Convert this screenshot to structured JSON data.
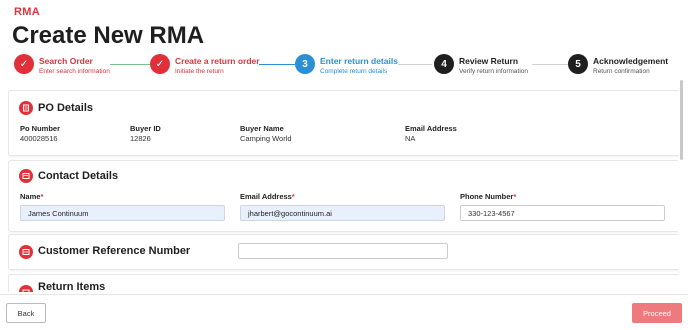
{
  "brand": "RMA",
  "title": "Create New RMA",
  "colors": {
    "accent": "#e0313a",
    "active": "#2b8fd6",
    "todo": "#1f1f1f",
    "proceed": "#ef7a7d"
  },
  "steps": [
    {
      "num": "✓",
      "title": "Search Order",
      "subtitle": "Enter search information",
      "state": "done"
    },
    {
      "num": "✓",
      "title": "Create a return order",
      "subtitle": "Initiate the return",
      "state": "done"
    },
    {
      "num": "3",
      "title": "Enter return details",
      "subtitle": "Complete return details",
      "state": "active"
    },
    {
      "num": "4",
      "title": "Review Return",
      "subtitle": "Verify return information",
      "state": "todo"
    },
    {
      "num": "5",
      "title": "Acknowledgement",
      "subtitle": "Return confirmation",
      "state": "todo"
    }
  ],
  "po": {
    "title": "PO Details",
    "fields": [
      {
        "label": "Po Number",
        "value": "400028516"
      },
      {
        "label": "Buyer ID",
        "value": "12826"
      },
      {
        "label": "Buyer Name",
        "value": "Camping World"
      },
      {
        "label": "Email Address",
        "value": "NA"
      }
    ]
  },
  "contact": {
    "title": "Contact Details",
    "name_label": "Name",
    "name_value": "James Continuum",
    "email_label": "Email Address",
    "email_value": "jharbert@gocontinuum.ai",
    "phone_label": "Phone Number",
    "phone_value": "330-123-4567",
    "required_mark": "*"
  },
  "customer_ref": {
    "title": "Customer Reference Number",
    "value": ""
  },
  "return_items": {
    "title": "Return Items"
  },
  "buttons": {
    "back": "Back",
    "proceed": "Proceed"
  }
}
